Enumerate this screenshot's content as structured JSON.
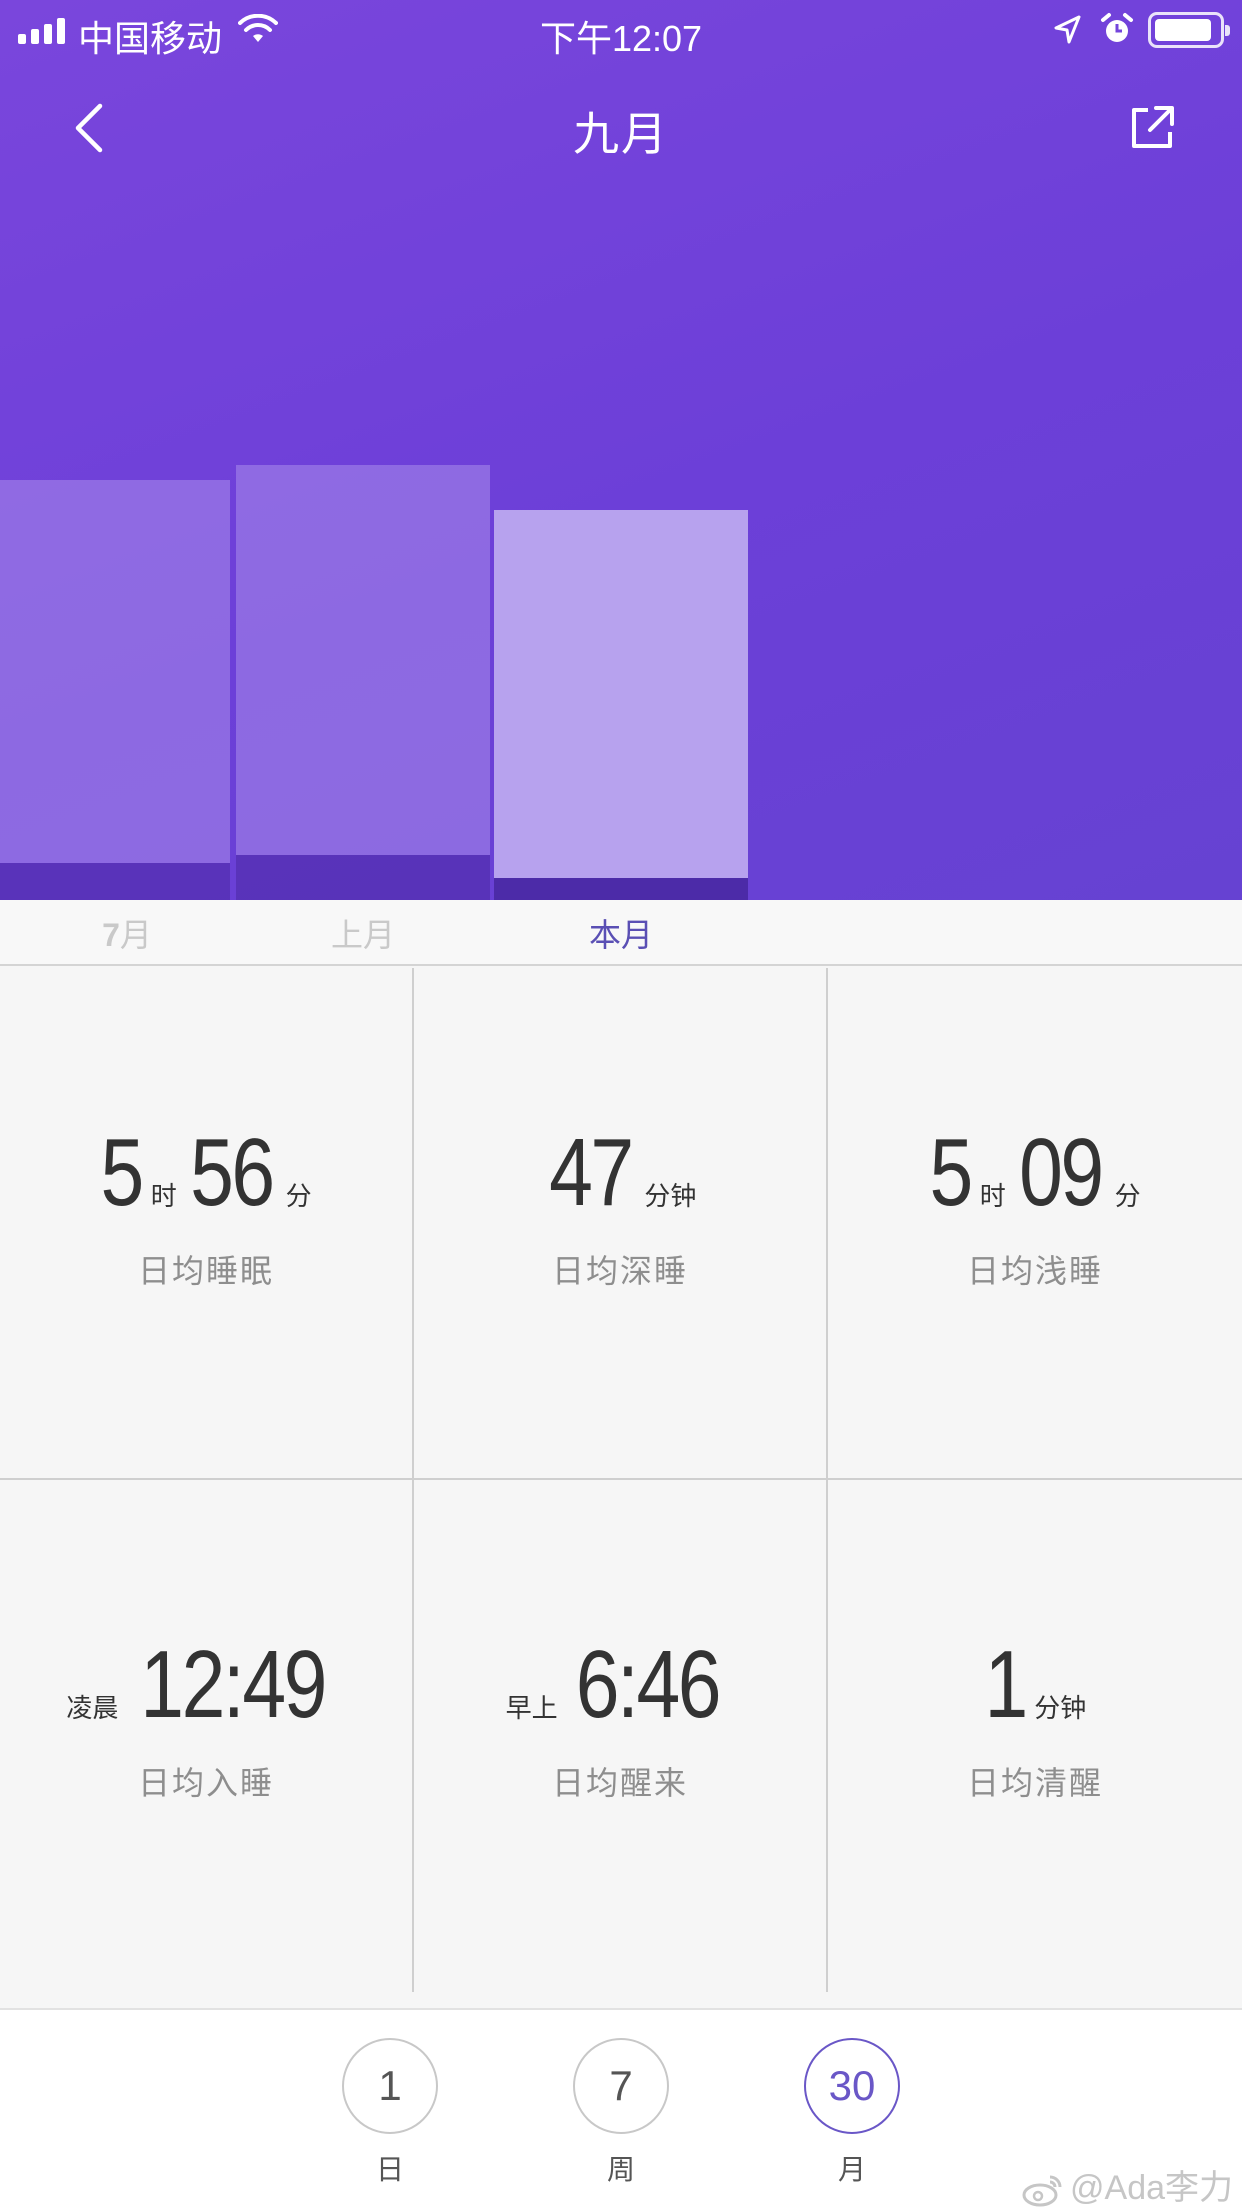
{
  "status_bar": {
    "carrier": "中国移动",
    "time": "下午12:07"
  },
  "header": {
    "title": "九月",
    "back_icon": "chevron-left-icon",
    "share_icon": "share-external-icon"
  },
  "colors": {
    "accent": "#5a4fb4",
    "hero_gradient_start": "#7a46dc",
    "hero_gradient_end": "#6642d2"
  },
  "chart_data": {
    "type": "bar",
    "categories": [
      "7月",
      "上月",
      "本月"
    ],
    "series": [
      {
        "values": [
          5.1,
          5.2,
          4.9
        ]
      },
      {
        "values": [
          0.5,
          0.6,
          0.3
        ]
      }
    ],
    "stacked": true,
    "grid": false
  },
  "period_tabs": [
    {
      "num": "7",
      "label": "月",
      "active": false
    },
    {
      "num": "",
      "label": "上月",
      "active": false
    },
    {
      "num": "",
      "label": "本月",
      "active": true
    }
  ],
  "stats": {
    "avg_sleep": {
      "hours": "5",
      "hours_unit": "时",
      "minutes": "56",
      "minutes_unit": "分",
      "label": "日均睡眠"
    },
    "avg_deep": {
      "minutes": "47",
      "minutes_unit": "分钟",
      "label": "日均深睡"
    },
    "avg_light": {
      "hours": "5",
      "hours_unit": "时",
      "minutes": "09",
      "minutes_unit": "分",
      "label": "日均浅睡"
    },
    "avg_bedtime": {
      "prefix": "凌晨",
      "time": "12:49",
      "label": "日均入睡"
    },
    "avg_wake": {
      "prefix": "早上",
      "time": "6:46",
      "label": "日均醒来"
    },
    "avg_awake": {
      "minutes": "1",
      "minutes_unit": "分钟",
      "label": "日均清醒"
    }
  },
  "range_selector": [
    {
      "value": "1",
      "label": "日",
      "active": false
    },
    {
      "value": "7",
      "label": "周",
      "active": false
    },
    {
      "value": "30",
      "label": "月",
      "active": true
    }
  ],
  "watermark": "@Ada李力"
}
